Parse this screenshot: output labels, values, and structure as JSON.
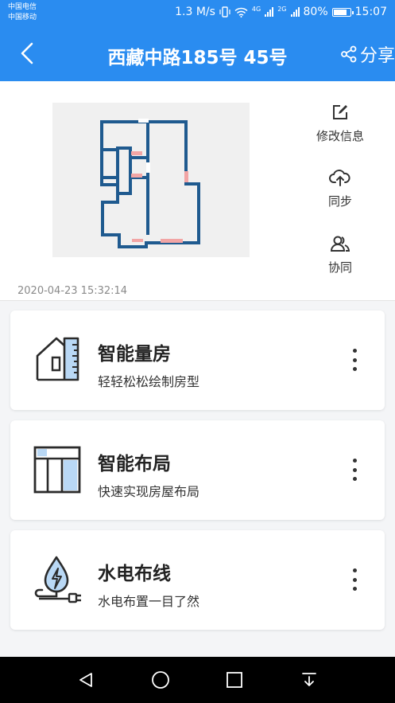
{
  "status_bar": {
    "carrier_1": "中国电信",
    "carrier_2": "中国移动",
    "speed": "1.3 M/s",
    "net1": "4G",
    "net2": "2G",
    "battery": "80%",
    "time": "15:07"
  },
  "header": {
    "title": "西藏中路185号 45号",
    "share_label": "分享",
    "color": "#2a8cf0"
  },
  "info": {
    "timestamp": "2020-04-23 15:32:14",
    "actions": [
      {
        "label": "修改信息",
        "icon": "edit-icon"
      },
      {
        "label": "同步",
        "icon": "cloud-upload-icon"
      },
      {
        "label": "协同",
        "icon": "collaborate-icon"
      }
    ]
  },
  "cards": [
    {
      "title": "智能量房",
      "subtitle": "轻轻松松绘制房型",
      "icon": "house-measure-icon"
    },
    {
      "title": "智能布局",
      "subtitle": "快速实现房屋布局",
      "icon": "layout-icon"
    },
    {
      "title": "水电布线",
      "subtitle": "水电布置一目了然",
      "icon": "plumbing-electric-icon"
    }
  ]
}
